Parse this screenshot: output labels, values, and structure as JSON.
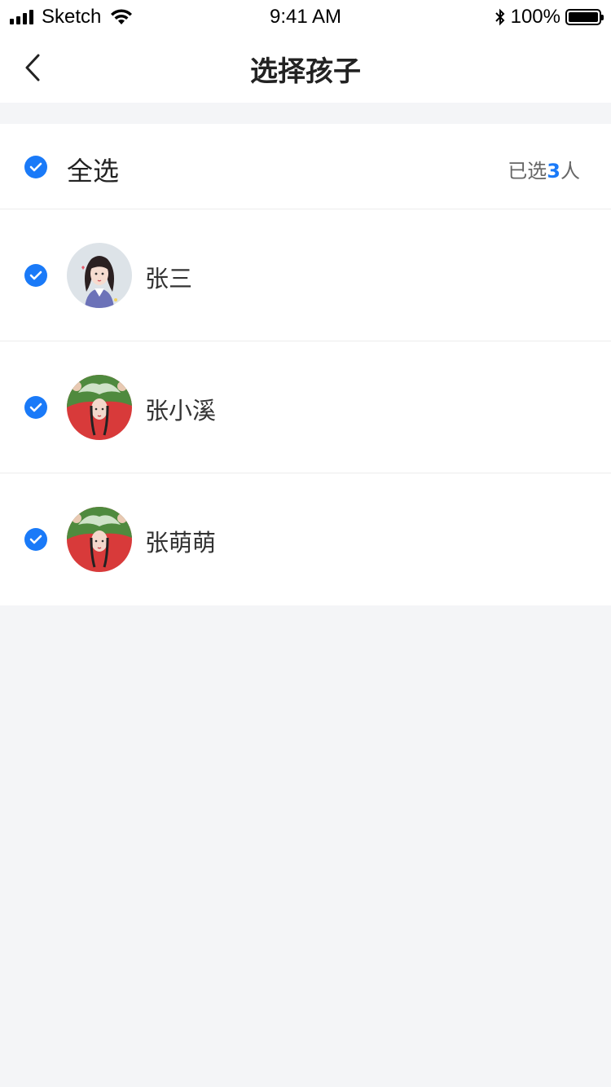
{
  "status_bar": {
    "carrier": "Sketch",
    "time": "9:41 AM",
    "battery_percent": "100%",
    "icons": [
      "signal-icon",
      "wifi-icon",
      "bluetooth-icon",
      "battery-icon"
    ]
  },
  "nav": {
    "title": "选择孩子",
    "back_icon": "chevron-left-icon"
  },
  "select_all": {
    "label": "全选",
    "checked": true,
    "count_prefix": "已选",
    "count": "3",
    "count_suffix": "人"
  },
  "children": [
    {
      "name": "张三",
      "checked": true,
      "avatar": "avatar-girl-light-background"
    },
    {
      "name": "张小溪",
      "checked": true,
      "avatar": "avatar-girl-red-green"
    },
    {
      "name": "张萌萌",
      "checked": true,
      "avatar": "avatar-girl-red-green"
    }
  ],
  "colors": {
    "accent": "#1a7af8",
    "page_background": "#f4f5f7",
    "card_background": "#ffffff",
    "text_primary": "#222222",
    "text_secondary": "#666666"
  }
}
